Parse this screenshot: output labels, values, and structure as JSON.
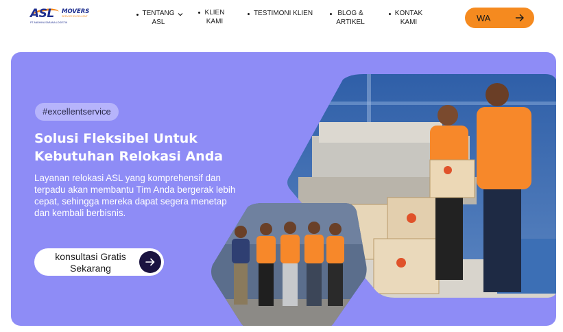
{
  "brand": {
    "logo_main": "ASL",
    "logo_movers": "MOVERS",
    "logo_tagline": "SERVICE EXCELLENT",
    "logo_company": "PT ANDHIKA SARANA LOGISTIK"
  },
  "nav": {
    "items": [
      {
        "label": "TENTANG ASL",
        "has_dropdown": true
      },
      {
        "label": "KLIEN KAMI",
        "has_dropdown": false
      },
      {
        "label": "TESTIMONI KLIEN",
        "has_dropdown": false
      },
      {
        "label": "BLOG & ARTIKEL",
        "has_dropdown": false
      },
      {
        "label": "KONTAK KAMI",
        "has_dropdown": false
      }
    ],
    "cta_label": "WA"
  },
  "hero": {
    "tag": "#excellentservice",
    "title": "Solusi Fleksibel Untuk Kebutuhan Relokasi Anda",
    "description": "Layanan relokasi ASL yang komprehensif dan terpadu akan membantu Tim Anda bergerak lebih cepat, sehingga mereka dapat segera menetap dan kembali berbisnis.",
    "cta_label": "konsultasi Gratis Sekarang",
    "photos": [
      {
        "name": "team-photo",
        "subject": "ASL movers team in orange uniforms"
      },
      {
        "name": "warehouse-photo",
        "subject": "Movers carrying ASL boxes in warehouse"
      }
    ]
  },
  "colors": {
    "accent_orange": "#f58a1f",
    "hero_bg": "#8e8cf6",
    "tag_bg": "#b6b4fb",
    "cta_dark": "#1a1340",
    "brand_blue": "#1f2f8f"
  }
}
